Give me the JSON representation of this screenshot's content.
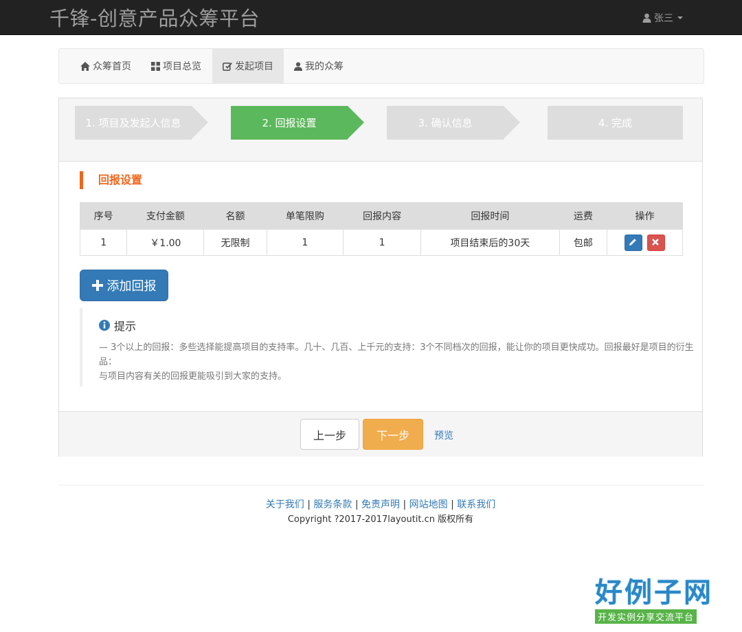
{
  "header": {
    "brand": "千锋-创意产品众筹平台",
    "user_name": "张三"
  },
  "nav": {
    "items": [
      {
        "label": "众筹首页",
        "icon": "home-icon"
      },
      {
        "label": "项目总览",
        "icon": "grid-icon"
      },
      {
        "label": "发起项目",
        "icon": "edit-icon",
        "active": true
      },
      {
        "label": "我的众筹",
        "icon": "user-icon"
      }
    ]
  },
  "steps": [
    {
      "label": "1. 项目及发起人信息",
      "state": "done"
    },
    {
      "label": "2. 回报设置",
      "state": "current"
    },
    {
      "label": "3. 确认信息",
      "state": "todo"
    },
    {
      "label": "4. 完成",
      "state": "todo"
    }
  ],
  "section": {
    "title": "回报设置"
  },
  "table": {
    "headers": [
      "序号",
      "支付金额",
      "名额",
      "单笔限购",
      "回报内容",
      "回报时间",
      "运费",
      "操作"
    ],
    "rows": [
      [
        "1",
        "￥1.00",
        "无限制",
        "1",
        "1",
        "项目结束后的30天",
        "包邮"
      ]
    ]
  },
  "add_button": {
    "label": "添加回报"
  },
  "tip": {
    "title": "提示",
    "line1": "— 3个以上的回报：多些选择能提高项目的支持率。几十、几百、上千元的支持：3个不同档次的回报，能让你的项目更快成功。回报最好是项目的衍生品：",
    "line2": "与项目内容有关的回报更能吸引到大家的支持。"
  },
  "actions": {
    "prev": "上一步",
    "next": "下一步",
    "preview": "预览"
  },
  "footer": {
    "links": [
      "关于我们",
      "服务条款",
      "免责声明",
      "网站地图",
      "联系我们"
    ],
    "separator": " | ",
    "copyright": "Copyright ?2017-2017layoutit.cn 版权所有"
  },
  "watermark": {
    "logo_title": "好例子网",
    "logo_subtitle": "开发实例分享交流平台"
  },
  "colors": {
    "topbar": "#222222",
    "step_active": "#5cb85c",
    "step_inactive": "#dddddd",
    "accent_orange": "#f0661c",
    "primary_blue": "#337ab7",
    "warning": "#f0ad4e",
    "danger": "#d9534f"
  }
}
